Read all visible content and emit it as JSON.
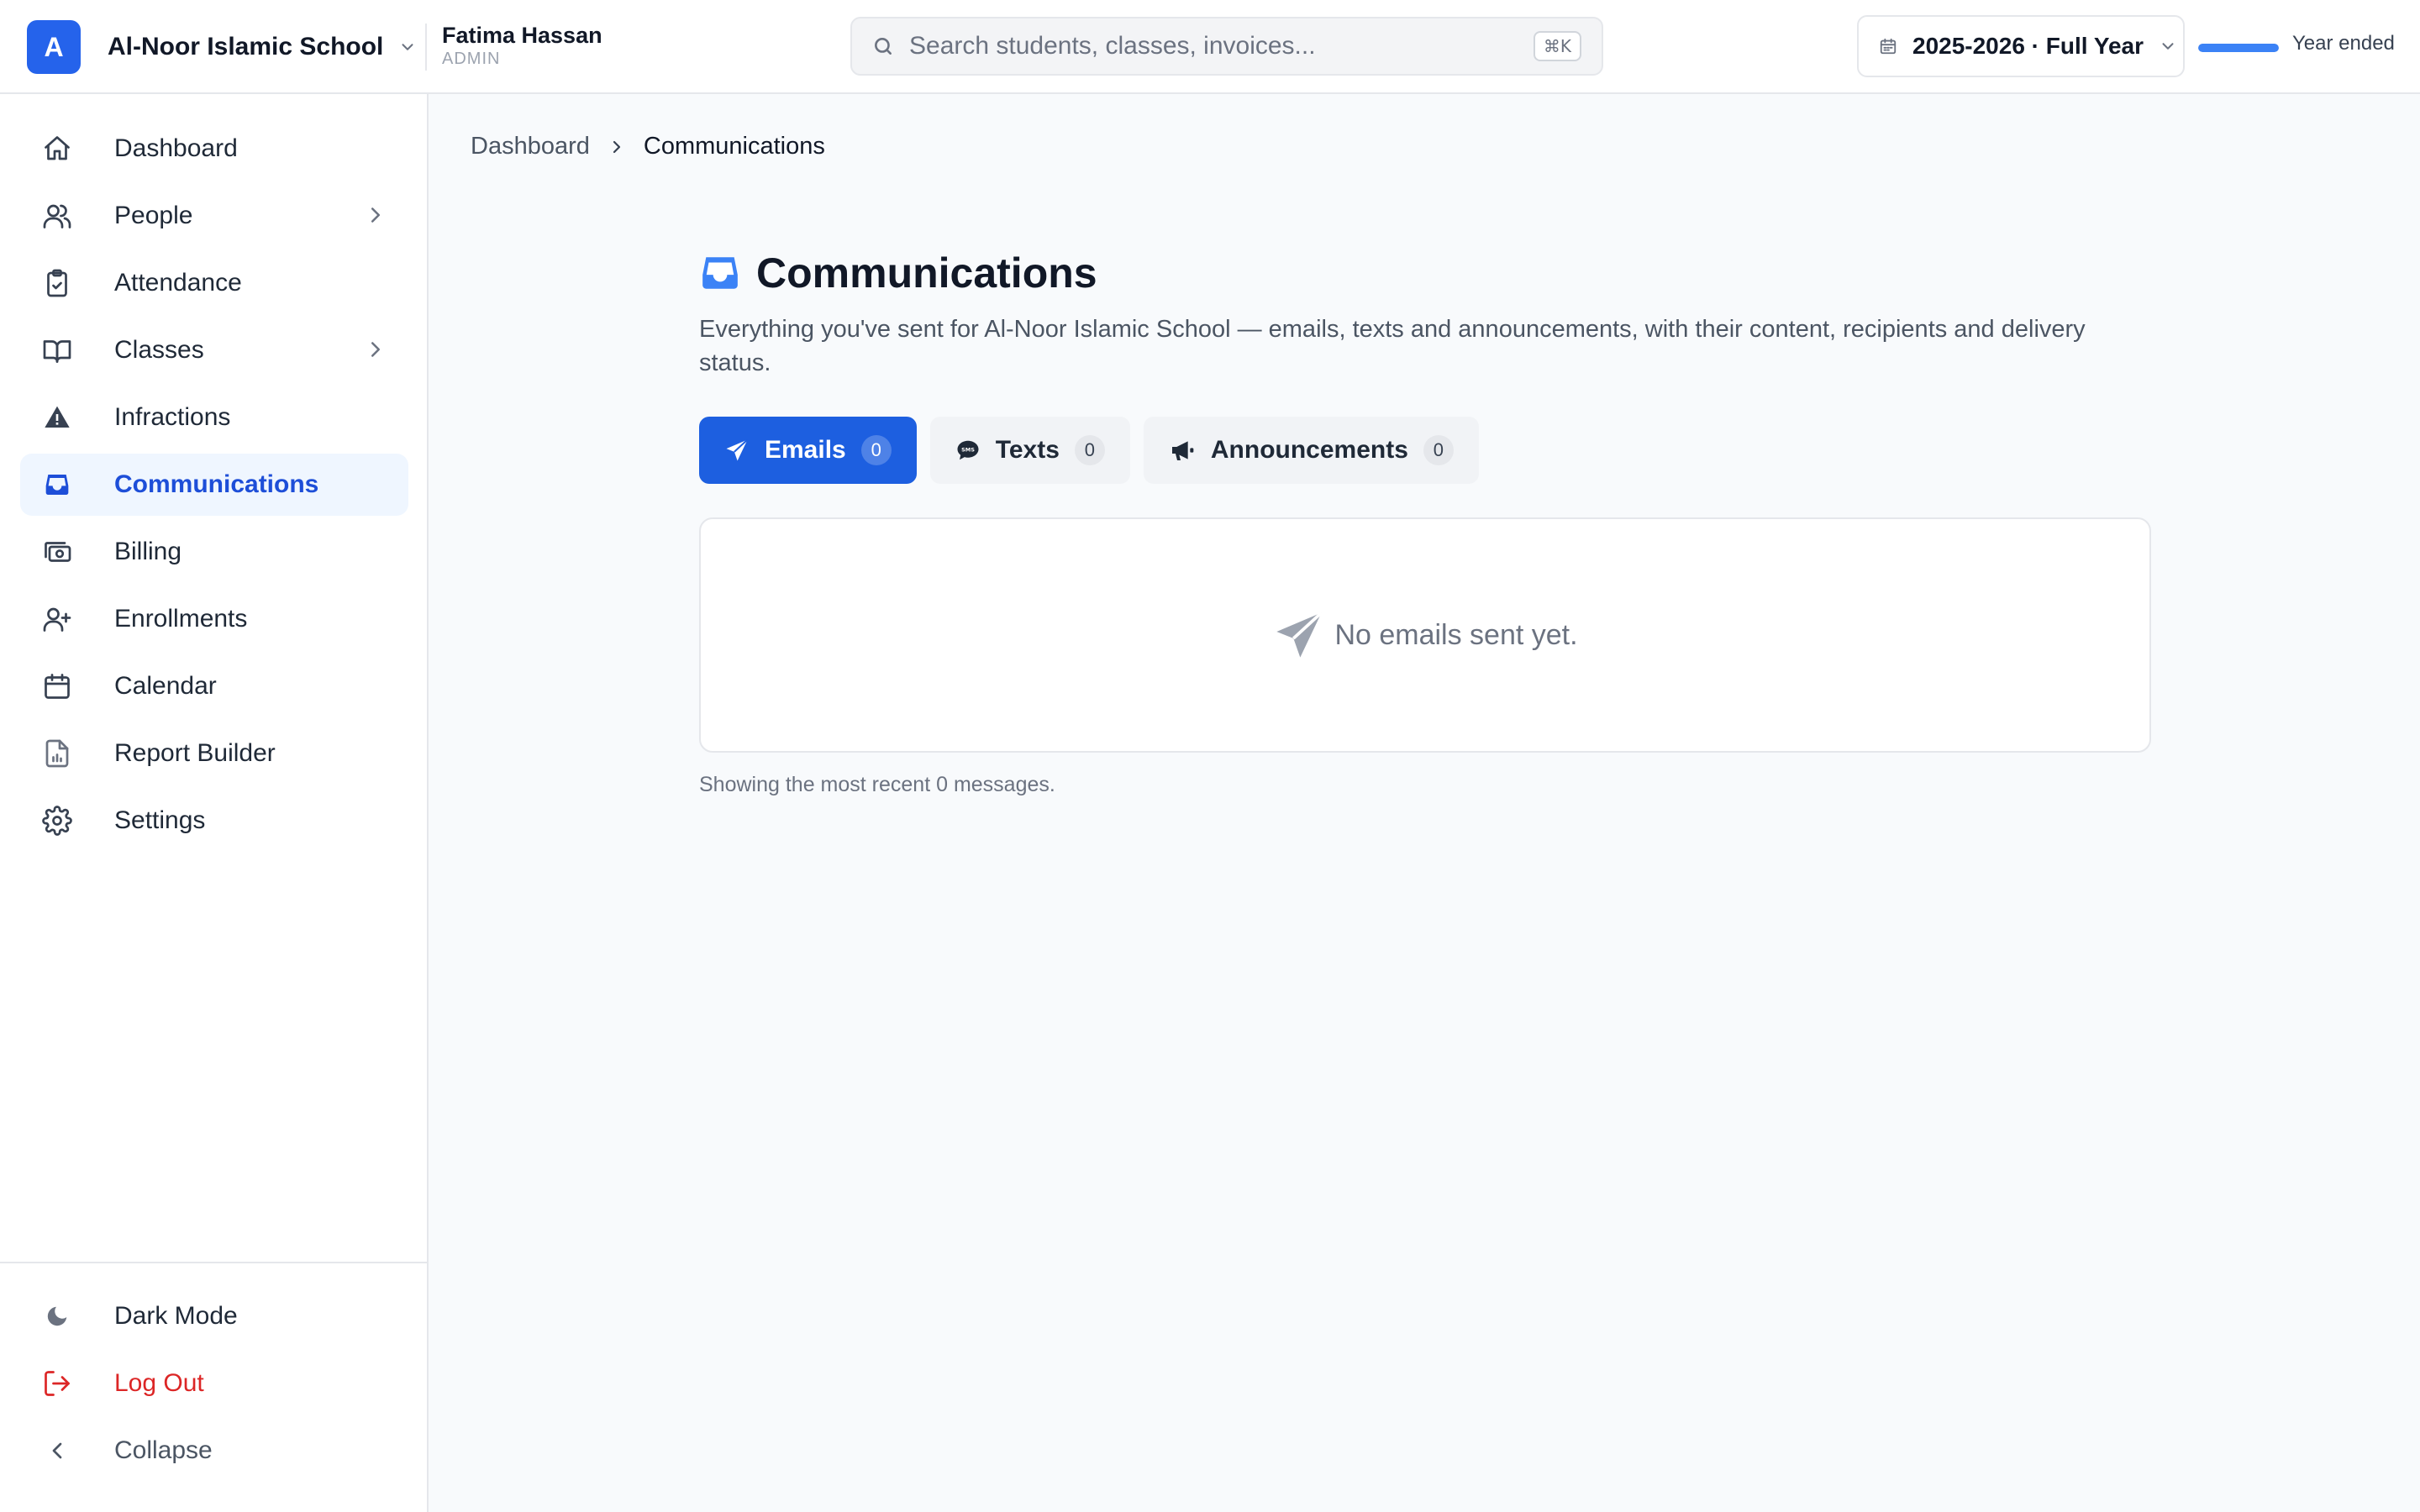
{
  "header": {
    "logo_letter": "A",
    "school_name": "Al-Noor Islamic School",
    "user_name": "Fatima Hassan",
    "user_role": "ADMIN",
    "search_placeholder": "Search students, classes, invoices...",
    "search_shortcut": "⌘K",
    "year_label": "2025-2026 · Full Year",
    "year_progress": 1.0,
    "year_status": "Year ended"
  },
  "sidebar": {
    "items": [
      {
        "label": "Dashboard"
      },
      {
        "label": "People"
      },
      {
        "label": "Attendance"
      },
      {
        "label": "Classes"
      },
      {
        "label": "Infractions"
      },
      {
        "label": "Communications"
      },
      {
        "label": "Billing"
      },
      {
        "label": "Enrollments"
      },
      {
        "label": "Calendar"
      },
      {
        "label": "Report Builder"
      },
      {
        "label": "Settings"
      }
    ],
    "bottom": {
      "dark_mode": "Dark Mode",
      "logout": "Log Out",
      "collapse": "Collapse"
    }
  },
  "breadcrumb": {
    "parent": "Dashboard",
    "current": "Communications"
  },
  "page": {
    "title": "Communications",
    "description": "Everything you've sent for Al-Noor Islamic School — emails, texts and announcements, with their content, recipients and delivery status."
  },
  "tabs": [
    {
      "label": "Emails",
      "count": "0"
    },
    {
      "label": "Texts",
      "count": "0"
    },
    {
      "label": "Announcements",
      "count": "0"
    }
  ],
  "empty_state": {
    "message": "No emails sent yet."
  },
  "footnote": "Showing the most recent 0 messages.",
  "colors": {
    "accent": "#2563eb",
    "active_tab": "#1d5fe0",
    "active_nav_bg": "#eff6ff",
    "danger": "#dc2626"
  }
}
